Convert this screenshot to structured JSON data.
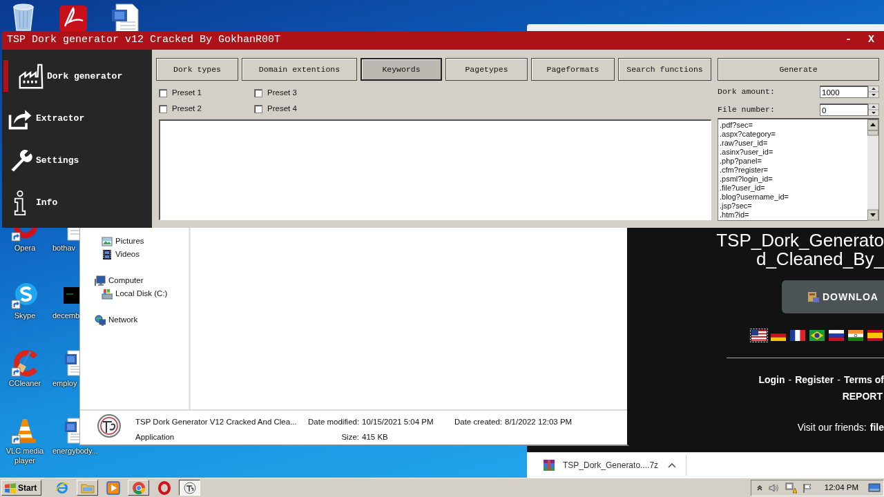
{
  "desktop": {
    "icons": [
      {
        "kind": "opera",
        "label": "Opera"
      },
      {
        "kind": "document",
        "label": "bothav"
      },
      {
        "kind": "skype",
        "label": "Skype"
      },
      {
        "kind": "terminal",
        "label": "decemb"
      },
      {
        "kind": "ccleaner",
        "label": "CCleaner"
      },
      {
        "kind": "word",
        "label": "employ"
      },
      {
        "kind": "vlc",
        "label": "VLC media player"
      },
      {
        "kind": "word",
        "label": "energybody..."
      }
    ]
  },
  "browser": {
    "title_lines": [
      "TSP_Dork_Generato",
      "d_Cleaned_By_"
    ],
    "download": "DOWNLOA",
    "flags": [
      {
        "kind": "us",
        "selected": true
      },
      {
        "kind": "de",
        "selected": false
      },
      {
        "kind": "fr",
        "selected": false
      },
      {
        "kind": "br",
        "selected": false
      },
      {
        "kind": "ru",
        "selected": false
      },
      {
        "kind": "in",
        "selected": false
      },
      {
        "kind": "es",
        "selected": false
      }
    ],
    "footer": [
      {
        "kind": "link",
        "text": "Login"
      },
      {
        "kind": "sep",
        "text": "-"
      },
      {
        "kind": "link",
        "text": "Register"
      },
      {
        "kind": "sep",
        "text": "-"
      },
      {
        "kind": "link",
        "text": "Terms of"
      }
    ],
    "report": "REPORT",
    "friends_label": "Visit our friends:",
    "friends_link": "file",
    "download_bar": {
      "file": "TSP_Dork_Generato....7z"
    }
  },
  "explorer": {
    "library_items": [
      {
        "kind": "pictures",
        "label": "Pictures"
      },
      {
        "kind": "videos",
        "label": "Videos"
      }
    ],
    "tree": [
      {
        "kind": "computer",
        "label": "Computer",
        "children": [
          {
            "kind": "disk",
            "label": "Local Disk (C:)"
          }
        ]
      },
      {
        "kind": "network",
        "label": "Network"
      }
    ],
    "details": {
      "name": "TSP Dork Generator V12 Cracked And Clea...",
      "type": "Application",
      "modified_label": "Date modified:",
      "modified": "10/15/2021 5:04 PM",
      "size_label": "Size:",
      "size": "415 KB",
      "created_label": "Date created:",
      "created": "8/1/2022 12:03 PM"
    }
  },
  "app": {
    "title": "TSP Dork generator v12 Cracked By GokhanR00T",
    "minimize": "-",
    "close": "X",
    "sidebar": [
      {
        "kind": "factory",
        "label": "Dork generator",
        "selected": true
      },
      {
        "kind": "export",
        "label": "Extractor",
        "selected": false
      },
      {
        "kind": "wrench",
        "label": "Settings",
        "selected": false
      },
      {
        "kind": "info",
        "label": "Info",
        "selected": false
      }
    ],
    "tabs": [
      {
        "label": "Dork types",
        "selected": false
      },
      {
        "label": "Domain extentions",
        "selected": false
      },
      {
        "label": "Keywords",
        "selected": true
      },
      {
        "label": "Pagetypes",
        "selected": false
      },
      {
        "label": "Pageformats",
        "selected": false
      },
      {
        "label": "Search functions",
        "selected": false
      }
    ],
    "generate": "Generate",
    "presets": [
      {
        "label": "Preset 1",
        "checked": false
      },
      {
        "label": "Preset 3",
        "checked": false
      },
      {
        "label": "Preset 2",
        "checked": false
      },
      {
        "label": "Preset 4",
        "checked": false
      }
    ],
    "dork_amount": {
      "label": "Dork amount:",
      "value": "1000"
    },
    "file_number": {
      "label": "File number:",
      "value": "0"
    },
    "extensions": [
      ".pdf?sec=",
      ".aspx?category=",
      ".raw?user_id=",
      ".asinx?user_id=",
      ".php?panel=",
      ".cfm?register=",
      ".psml?login_id=",
      ".file?user_id=",
      ".blog?username_id=",
      ".jsp?sec=",
      ".htm?id="
    ]
  },
  "taskbar": {
    "start": "Start",
    "apps": [
      {
        "kind": "ie",
        "open": false,
        "selected": false
      },
      {
        "kind": "explorer",
        "open": true,
        "selected": false
      },
      {
        "kind": "media",
        "open": false,
        "selected": false
      },
      {
        "kind": "chrome",
        "open": true,
        "selected": false
      },
      {
        "kind": "opera",
        "open": false,
        "selected": false
      },
      {
        "kind": "tsp",
        "open": true,
        "selected": true
      }
    ],
    "clock": "12:04 PM"
  }
}
